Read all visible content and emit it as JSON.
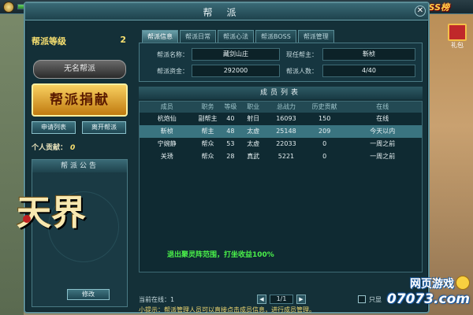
{
  "hud": {
    "boss_logo": "BOSS榜",
    "gift_label": "礼包"
  },
  "window": {
    "title": "帮派",
    "close": "✕"
  },
  "left": {
    "rank_label": "帮派等级",
    "rank_value": "2",
    "guild_name": "无名帮派",
    "donate_button": "帮派捐献",
    "apply_list_button": "申请列表",
    "leave_button": "离开帮派",
    "contribution_label": "个人贡献：",
    "contribution_value": "0",
    "notice_title": "帮派公告",
    "calligraphy": "天界",
    "edit_button": "修改"
  },
  "tabs": [
    {
      "label": "帮派信息",
      "active": true
    },
    {
      "label": "帮派日常",
      "active": false
    },
    {
      "label": "帮派心法",
      "active": false
    },
    {
      "label": "帮派BOSS",
      "active": false
    },
    {
      "label": "帮派管理",
      "active": false
    }
  ],
  "info": {
    "name_label": "帮派名称：",
    "name_value": "藏剑山庄",
    "leader_label": "现任帮主：",
    "leader_value": "靳桢",
    "funds_label": "帮派资金：",
    "funds_value": "292000",
    "members_label": "帮派人数：",
    "members_value": "4/40"
  },
  "members": {
    "title": "成员列表",
    "headers": [
      "成员",
      "职务",
      "等级",
      "职业",
      "总战力",
      "历史贡献",
      "在线"
    ],
    "rows": [
      {
        "cells": [
          "杭炮仙",
          "副帮主",
          "40",
          "射日",
          "16093",
          "150",
          "在线"
        ],
        "highlight": false
      },
      {
        "cells": [
          "靳桢",
          "帮主",
          "48",
          "太虚",
          "25148",
          "209",
          "今天以内"
        ],
        "highlight": true
      },
      {
        "cells": [
          "宁婉静",
          "帮众",
          "53",
          "太虚",
          "22033",
          "0",
          "一周之前"
        ],
        "highlight": false
      },
      {
        "cells": [
          "关琇",
          "帮众",
          "28",
          "真武",
          "5221",
          "0",
          "一周之前"
        ],
        "highlight": false
      }
    ]
  },
  "system_tip": "退出聚灵阵范围，打坐收益100%",
  "pager": {
    "online_label": "当前在线：1",
    "page": "1/1",
    "prev": "◀",
    "next": "▶",
    "checkbox_label": "只显"
  },
  "hint": "小提示：帮派管理人员可以直接点击成员信息，进行成员管理。",
  "watermark": {
    "top": "网页游戏",
    "bottom": "07073.com"
  }
}
